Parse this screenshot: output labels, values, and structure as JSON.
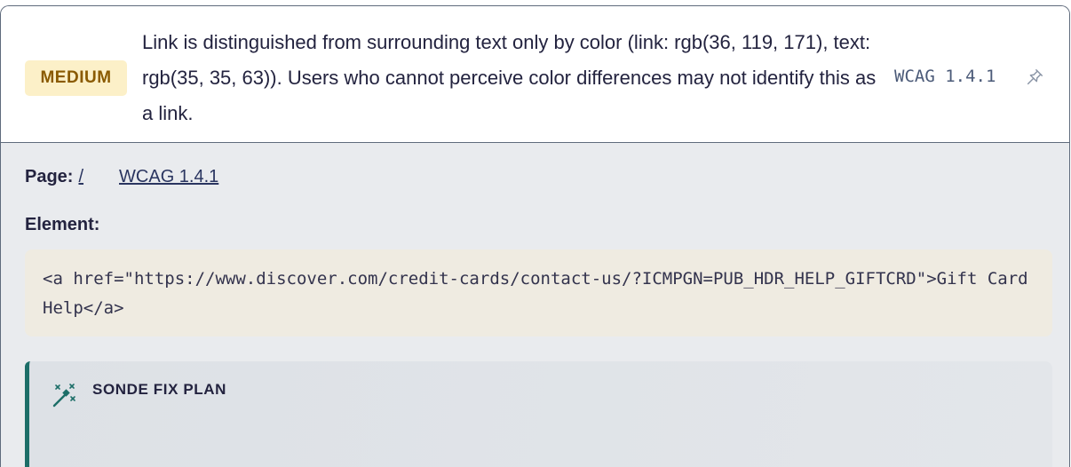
{
  "issue": {
    "severity": "MEDIUM",
    "description": "Link is distinguished from surrounding text only by color (link: rgb(36, 119, 171), text: rgb(35, 35, 63)). Users who cannot perceive color differences may not identify this as a link.",
    "wcag_tag": "WCAG 1.4.1",
    "pin_icon": "pin-icon"
  },
  "details": {
    "page_label": "Page:",
    "page_link": "/",
    "wcag_link": "WCAG 1.4.1",
    "element_label": "Element:",
    "element_code": "<a href=\"https://www.discover.com/credit-cards/contact-us/?ICMPGN=PUB_HDR_HELP_GIFTCRD\">Gift Card Help</a>"
  },
  "fix_plan": {
    "title": "SONDE FIX PLAN",
    "icon": "magic-wand-icon"
  },
  "colors": {
    "severity_bg": "#fcf0c8",
    "severity_text": "#8a5a00",
    "fix_accent": "#1c6e68"
  }
}
